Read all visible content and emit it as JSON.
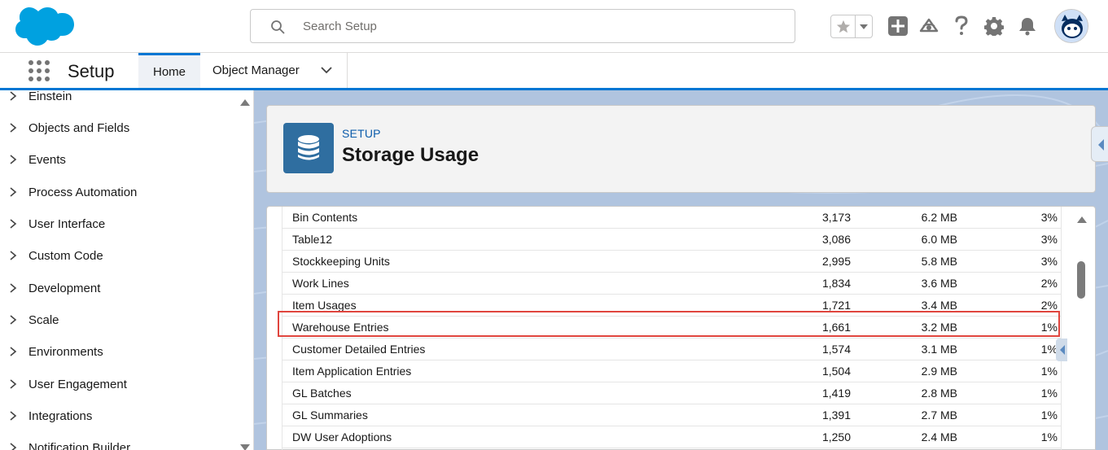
{
  "header": {
    "search_placeholder": "Search Setup"
  },
  "nav": {
    "app_name": "Setup",
    "tabs": [
      {
        "label": "Home"
      },
      {
        "label": "Object Manager"
      }
    ]
  },
  "sidebar": {
    "items": [
      {
        "label": "Einstein"
      },
      {
        "label": "Objects and Fields"
      },
      {
        "label": "Events"
      },
      {
        "label": "Process Automation"
      },
      {
        "label": "User Interface"
      },
      {
        "label": "Custom Code"
      },
      {
        "label": "Development"
      },
      {
        "label": "Scale"
      },
      {
        "label": "Environments"
      },
      {
        "label": "User Engagement"
      },
      {
        "label": "Integrations"
      },
      {
        "label": "Notification Builder"
      }
    ]
  },
  "page": {
    "breadcrumb": "SETUP",
    "title": "Storage Usage"
  },
  "table": {
    "rows": [
      {
        "name": "Bin Contents",
        "count": "3,173",
        "size": "6.2 MB",
        "pct": "3%"
      },
      {
        "name": "Table12",
        "count": "3,086",
        "size": "6.0 MB",
        "pct": "3%"
      },
      {
        "name": "Stockkeeping Units",
        "count": "2,995",
        "size": "5.8 MB",
        "pct": "3%"
      },
      {
        "name": "Work Lines",
        "count": "1,834",
        "size": "3.6 MB",
        "pct": "2%"
      },
      {
        "name": "Item Usages",
        "count": "1,721",
        "size": "3.4 MB",
        "pct": "2%"
      },
      {
        "name": "Warehouse Entries",
        "count": "1,661",
        "size": "3.2 MB",
        "pct": "1%"
      },
      {
        "name": "Customer Detailed Entries",
        "count": "1,574",
        "size": "3.1 MB",
        "pct": "1%"
      },
      {
        "name": "Item Application Entries",
        "count": "1,504",
        "size": "2.9 MB",
        "pct": "1%"
      },
      {
        "name": "GL Batches",
        "count": "1,419",
        "size": "2.8 MB",
        "pct": "1%"
      },
      {
        "name": "GL Summaries",
        "count": "1,391",
        "size": "2.7 MB",
        "pct": "1%"
      },
      {
        "name": "DW User Adoptions",
        "count": "1,250",
        "size": "2.4 MB",
        "pct": "1%"
      }
    ]
  },
  "icons": {
    "logo": "salesforce-cloud-logo",
    "search": "search-icon",
    "favorites": "star-icon",
    "add": "plus-icon",
    "trailhead": "trailhead-icon",
    "help": "question-icon",
    "settings": "gear-icon",
    "notifications": "bell-icon",
    "page_header": "database-icon"
  },
  "colors": {
    "brand": "#0176d3",
    "header_icon_bg": "#2f6ea0",
    "highlight_border": "#e0453e",
    "background": "#b0c4df"
  }
}
